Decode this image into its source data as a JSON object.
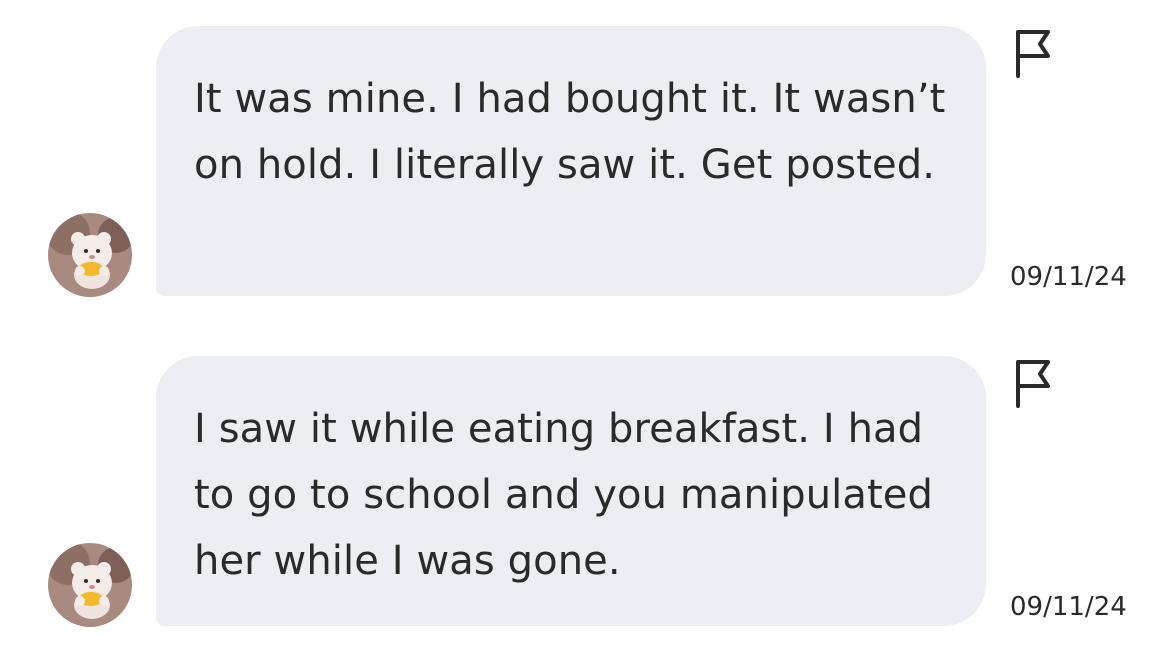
{
  "messages": [
    {
      "text": "It was mine. I had bought it. It wasn’t on hold. I literally saw it. Get posted.",
      "date": "09/11/24",
      "avatar_icon": "bear-sticker-avatar",
      "flag_icon": "report-flag-icon"
    },
    {
      "text": "I saw it while eating breakfast. I had to go to school and you manipulated her while I was gone.",
      "date": "09/11/24",
      "avatar_icon": "bear-sticker-avatar",
      "flag_icon": "report-flag-icon"
    }
  ],
  "colors": {
    "bubble_background": "#edeef3",
    "text": "#2a2a2c",
    "page_background": "#ffffff"
  }
}
